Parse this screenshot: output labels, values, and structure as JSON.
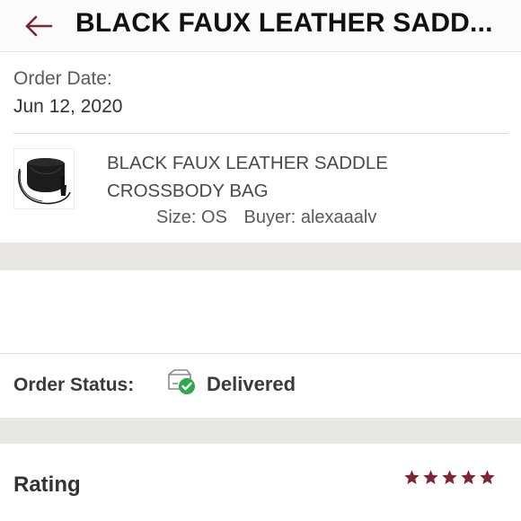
{
  "header": {
    "title": "BLACK FAUX LEATHER SADD..."
  },
  "order": {
    "date_label": "Order Date:",
    "date_value": "Jun 12, 2020"
  },
  "product": {
    "name": "BLACK FAUX LEATHER SADDLE CROSSBODY BAG",
    "size": "Size: OS",
    "buyer": "Buyer: alexaaalv"
  },
  "status": {
    "label": "Order Status:",
    "value": "Delivered",
    "icon": "delivered-box-check-icon",
    "check_color": "#2fa84f"
  },
  "rating": {
    "label": "Rating",
    "stars": 5,
    "max": 5,
    "star_color": "#7d2535"
  },
  "theme": {
    "accent": "#7d2535",
    "band": "#e9e7e5"
  }
}
